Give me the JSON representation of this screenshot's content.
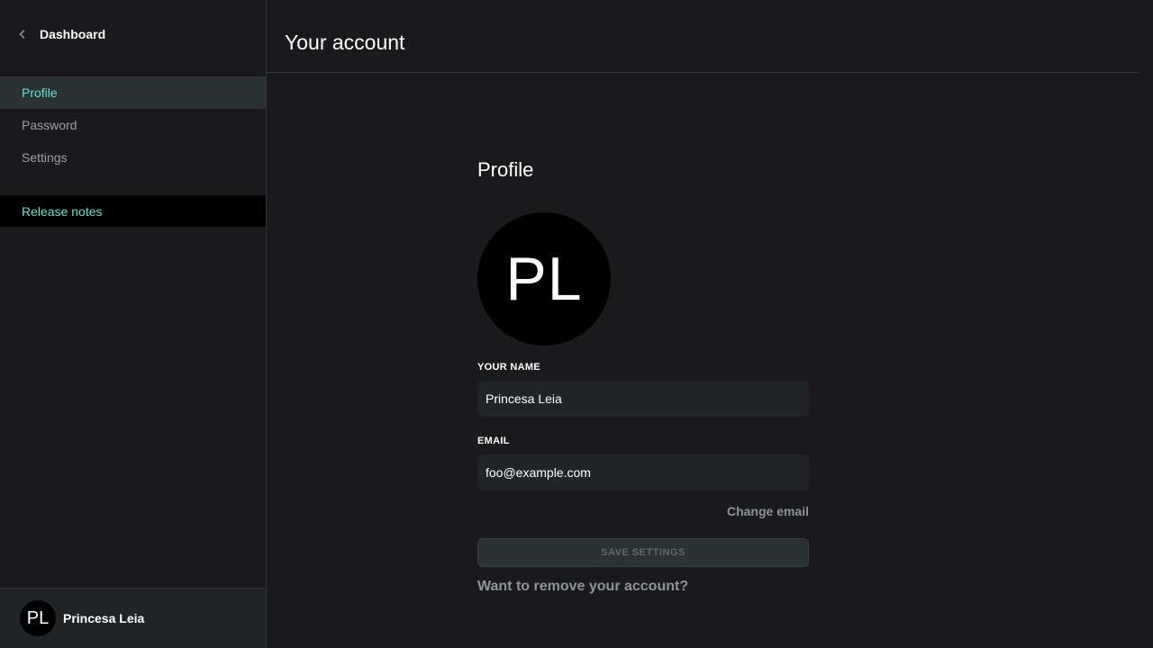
{
  "sidebar": {
    "back_label": "Dashboard",
    "back_icon": "chevron-left-icon",
    "items": [
      {
        "label": "Profile",
        "active": true
      },
      {
        "label": "Password",
        "active": false
      },
      {
        "label": "Settings",
        "active": false
      }
    ],
    "release_notes_label": "Release notes",
    "user": {
      "initials": "PL",
      "name": "Princesa Leia"
    }
  },
  "header": {
    "title": "Your account"
  },
  "profile": {
    "section_title": "Profile",
    "avatar_initials": "PL",
    "name_label": "YOUR NAME",
    "name_value": "Princesa Leia",
    "email_label": "EMAIL",
    "email_value": "foo@example.com",
    "change_email_label": "Change email",
    "save_label": "SAVE SETTINGS",
    "remove_account_label": "Want to remove your account?"
  },
  "colors": {
    "background": "#1a1a1c",
    "accent": "#5fe3d1",
    "muted_text": "#9aa0a6",
    "input_bg": "#212527"
  }
}
